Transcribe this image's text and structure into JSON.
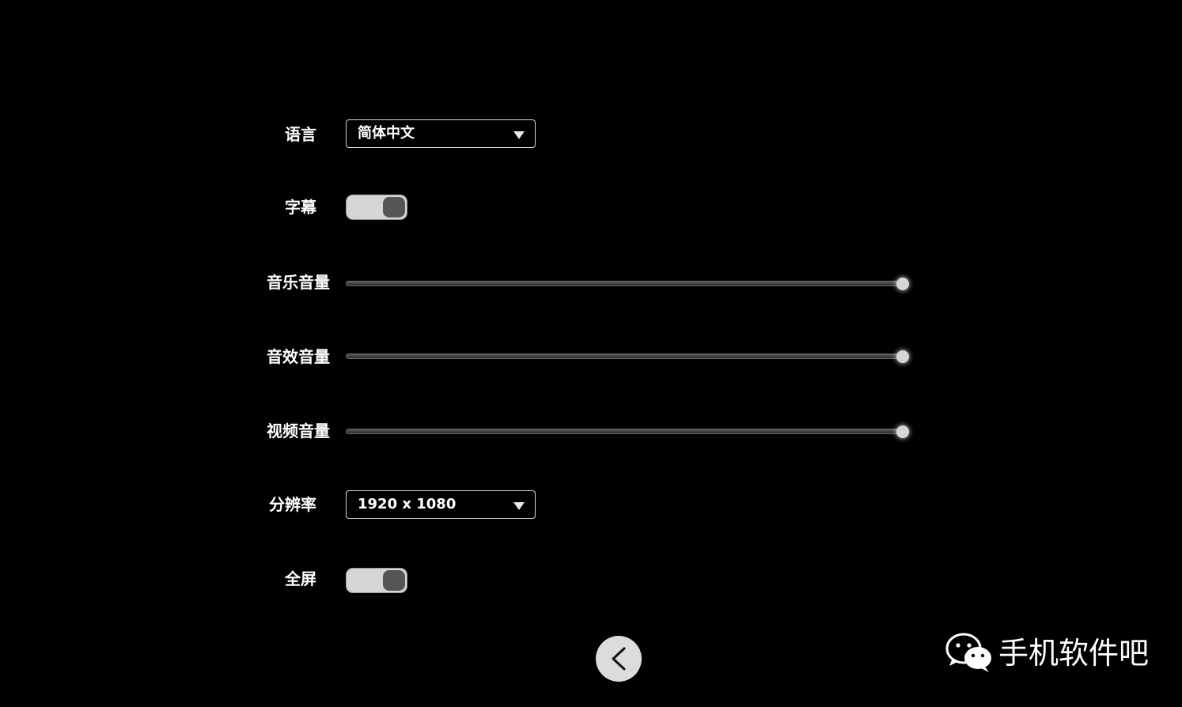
{
  "settings": {
    "language": {
      "label": "语言",
      "value": "简体中文"
    },
    "subtitles": {
      "label": "字幕",
      "on": true
    },
    "music_volume": {
      "label": "音乐音量",
      "level": 1.0
    },
    "sfx_volume": {
      "label": "音效音量",
      "level": 1.0
    },
    "video_volume": {
      "label": "视频音量",
      "level": 1.0
    },
    "resolution": {
      "label": "分辨率",
      "value": "1920 x 1080"
    },
    "fullscreen": {
      "label": "全屏",
      "on": true
    }
  },
  "back_button": {
    "icon": "chevron-left-icon"
  },
  "watermark": {
    "icon": "wechat-icon",
    "text": "手机软件吧"
  },
  "colors": {
    "background": "#000000",
    "text": "#ffffff",
    "toggle_track": "#d6d6d6",
    "toggle_knob": "#555555",
    "slider_thumb": "#d6d6d6"
  }
}
